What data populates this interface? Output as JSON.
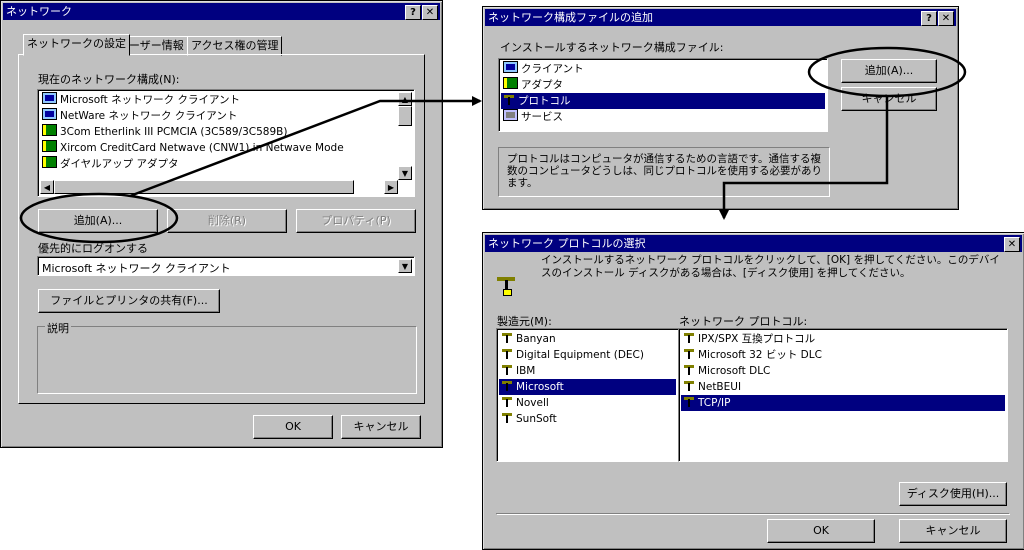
{
  "network_window": {
    "title": "ネットワーク",
    "help_btn": "?",
    "close_btn": "✕",
    "tabs": [
      "ネットワークの設定",
      "ユーザー情報",
      "アクセス権の管理"
    ],
    "components_label": "現在のネットワーク構成(N):",
    "components": [
      {
        "icon": "pc",
        "label": "Microsoft ネットワーク クライアント"
      },
      {
        "icon": "pc",
        "label": "NetWare ネットワーク クライアント"
      },
      {
        "icon": "nic",
        "label": "3Com Etherlink III PCMCIA (3C589/3C589B)"
      },
      {
        "icon": "nic",
        "label": "Xircom CreditCard Netwave (CNW1) in Netwave Mode"
      },
      {
        "icon": "nic",
        "label": "ダイヤルアップ アダプタ"
      }
    ],
    "add_button": "追加(A)...",
    "remove_button": "削除(R)",
    "properties_button": "プロパティ(P)",
    "primary_logon_label": "優先的にログオンする",
    "primary_logon_value": "Microsoft ネットワーク クライアント",
    "file_share_button": "ファイルとプリンタの共有(F)...",
    "description_label": "説明",
    "ok_button": "OK",
    "cancel_button": "キャンセル"
  },
  "add_window": {
    "title": "ネットワーク構成ファイルの追加",
    "help_btn": "?",
    "close_btn": "✕",
    "prompt": "インストールするネットワーク構成ファイル:",
    "types": [
      {
        "icon": "pc",
        "label": "クライアント"
      },
      {
        "icon": "nic",
        "label": "アダプタ"
      },
      {
        "icon": "proto",
        "label": "プロトコル",
        "selected": true
      },
      {
        "icon": "svc",
        "label": "サービス"
      }
    ],
    "add_button": "追加(A)...",
    "cancel_button": "キャンセル",
    "description": "プロトコルはコンピュータが通信するための言語です。通信する複数のコンピュータどうしは、同じプロトコルを使用する必要があります。"
  },
  "protocol_window": {
    "title": "ネットワーク プロトコルの選択",
    "close_btn": "✕",
    "instruction": "インストールするネットワーク プロトコルをクリックして、[OK] を押してください。このデバイスのインストール ディスクがある場合は、[ディスク使用] を押してください。",
    "manufacturers_label": "製造元(M):",
    "manufacturers": [
      {
        "label": "Banyan"
      },
      {
        "label": "Digital Equipment (DEC)"
      },
      {
        "label": "IBM"
      },
      {
        "label": "Microsoft",
        "selected": true
      },
      {
        "label": "Novell"
      },
      {
        "label": "SunSoft"
      }
    ],
    "protocols_label": "ネットワーク プロトコル:",
    "protocols": [
      {
        "label": "IPX/SPX 互換プロトコル"
      },
      {
        "label": "Microsoft 32 ビット DLC"
      },
      {
        "label": "Microsoft DLC"
      },
      {
        "label": "NetBEUI"
      },
      {
        "label": "TCP/IP",
        "selected": true
      }
    ],
    "have_disk_button": "ディスク使用(H)...",
    "ok_button": "OK",
    "cancel_button": "キャンセル"
  }
}
